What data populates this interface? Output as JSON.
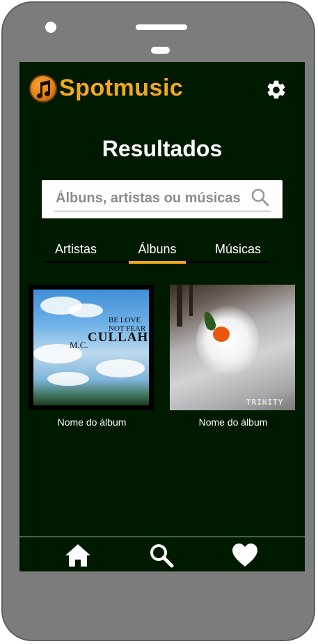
{
  "app": {
    "brand": "Spotmusic",
    "logo_icon": "music-note-icon",
    "settings_icon": "gear-icon"
  },
  "page": {
    "title": "Resultados"
  },
  "search": {
    "placeholder": "Álbuns, artistas ou músicas",
    "value": "",
    "icon": "search-icon"
  },
  "tabs": [
    {
      "label": "Artistas",
      "active": false
    },
    {
      "label": "Álbuns",
      "active": true
    },
    {
      "label": "Músicas",
      "active": false
    }
  ],
  "albums": [
    {
      "caption": "Nome do álbum",
      "cover_text": [
        "BE LOVE",
        "NOT FEAR",
        "CULLAH",
        "M.C."
      ]
    },
    {
      "caption": "Nome do álbum",
      "cover_text": [
        "TRINITY"
      ]
    }
  ],
  "bottom_nav": [
    {
      "name": "home",
      "icon": "home-icon"
    },
    {
      "name": "search",
      "icon": "search-icon"
    },
    {
      "name": "favorites",
      "icon": "heart-icon"
    }
  ],
  "colors": {
    "accent": "#f3a81b",
    "background": "#001a00",
    "phone_frame": "#7c7c7c"
  }
}
